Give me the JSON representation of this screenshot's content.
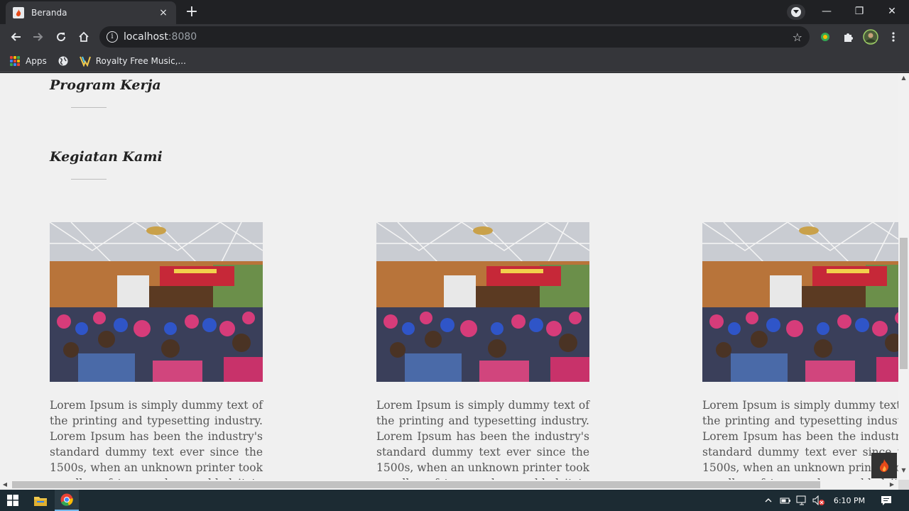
{
  "browser": {
    "tab_title": "Beranda",
    "tab_close": "×",
    "new_tab": "+",
    "url_host": "localhost",
    "url_port": ":8080",
    "window_controls": {
      "minimize": "—",
      "restore": "❐",
      "close": "✕"
    }
  },
  "bookmarks": {
    "items": [
      {
        "label": "Apps",
        "icon": "apps-grid-icon"
      },
      {
        "label": "",
        "icon": "globe-icon"
      },
      {
        "label": "Royalty Free Music,...",
        "icon": "royalty-free-music-icon"
      }
    ]
  },
  "page": {
    "sections": [
      {
        "title": "Program Kerja"
      },
      {
        "title": "Kegiatan Kami"
      }
    ],
    "cards": [
      {
        "image": "activity-photo-seminar",
        "text": "Lorem Ipsum is simply dummy text of the printing and typesetting industry. Lorem Ipsum has been the industry's standard dummy text ever since the 1500s, when an unknown printer took a galley of type and scrambled it to make a type specimen book."
      },
      {
        "image": "activity-photo-seminar",
        "text": "Lorem Ipsum is simply dummy text of the printing and typesetting industry. Lorem Ipsum has been the industry's standard dummy text ever since the 1500s, when an unknown printer took a galley of type and scrambled it to make a type specimen book."
      },
      {
        "image": "activity-photo-seminar",
        "text": "Lorem Ipsum is simply dummy text of the printing and typesetting industry. Lorem Ipsum has been the industry's standard dummy text ever since the 1500s, when an unknown printer took a galley of type and scrambled it to make a type specimen book."
      }
    ]
  },
  "taskbar": {
    "time": "6:10 PM"
  },
  "colors": {
    "chrome_dark": "#202124",
    "chrome_toolbar": "#35363a",
    "page_bg": "#f0f0f0",
    "taskbar_bg": "#1c2b33",
    "banner_red": "#c62838"
  }
}
